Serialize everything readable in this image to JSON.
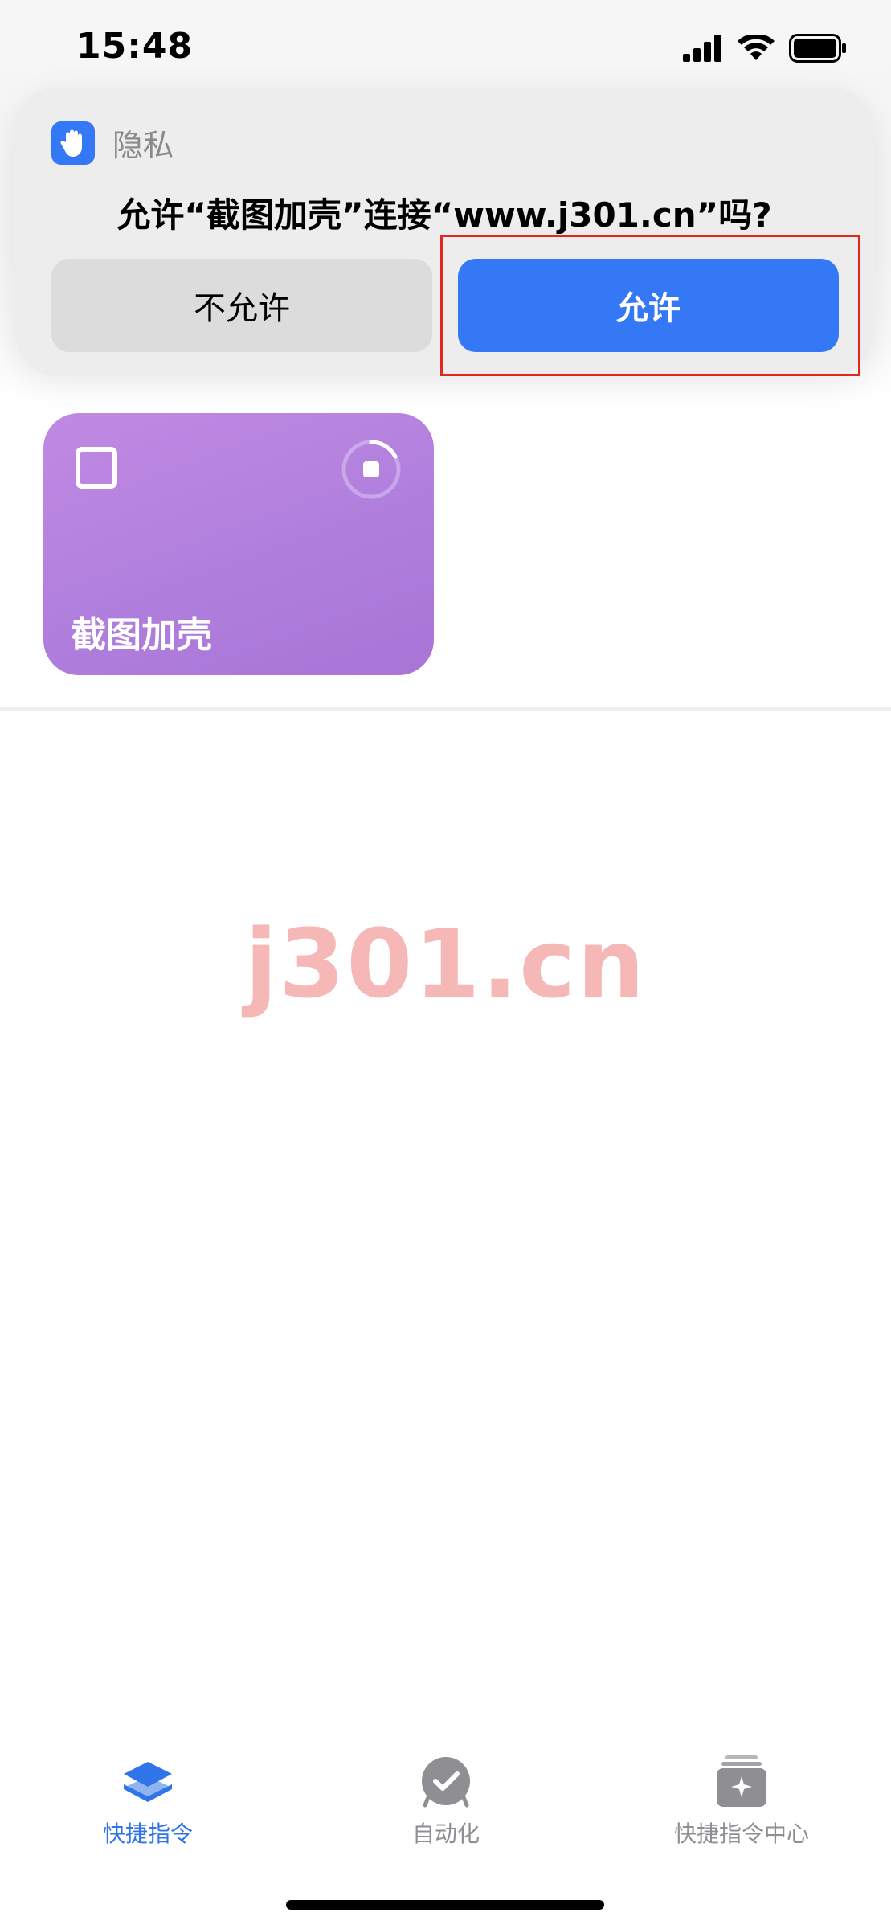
{
  "status_bar": {
    "time": "15:48"
  },
  "notification": {
    "app_name": "隐私",
    "question": "允许“截图加壳”连接“www.j301.cn”吗?",
    "deny_label": "不允许",
    "allow_label": "允许",
    "accent_color": "#3478f6",
    "highlight_color": "#e0281e"
  },
  "shortcut_card": {
    "title": "截图加壳",
    "color": "#b07fdd"
  },
  "watermark": {
    "text": "j301.cn"
  },
  "tab_bar": {
    "tabs": [
      {
        "label": "快捷指令",
        "icon": "layers-icon",
        "active": true
      },
      {
        "label": "自动化",
        "icon": "clock-check-icon",
        "active": false
      },
      {
        "label": "快捷指令中心",
        "icon": "gallery-sparkle-icon",
        "active": false
      }
    ]
  }
}
